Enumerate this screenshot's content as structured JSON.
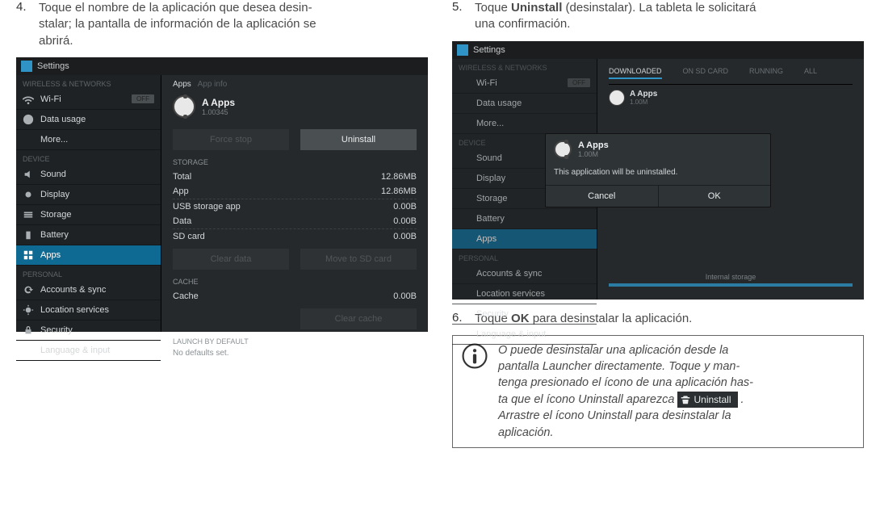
{
  "left": {
    "step_num": "4.",
    "step_text_a": "Toque el nombre de la aplicación que desea desin-",
    "step_text_b": "stalar; la pantalla de información de la aplicación se",
    "step_text_c": "abrirá."
  },
  "right": {
    "step5_num": "5.",
    "step5_a": "Toque ",
    "step5_bold": "Uninstall",
    "step5_b": " (desinstalar). La tableta le solicitará",
    "step5_c": "una confirmación.",
    "step6_num": "6.",
    "step6_a": "Toque ",
    "step6_bold": "OK",
    "step6_b": " para desinstalar la aplicación."
  },
  "shot_common": {
    "title": "Settings",
    "wireless_hdr": "WIRELESS & NETWORKS",
    "wifi": "Wi-Fi",
    "off": "OFF",
    "datausage": "Data usage",
    "more": "More...",
    "device_hdr": "DEVICE",
    "sound": "Sound",
    "display": "Display",
    "storage": "Storage",
    "battery": "Battery",
    "apps": "Apps",
    "personal_hdr": "PERSONAL",
    "accounts": "Accounts & sync",
    "location": "Location services",
    "security": "Security",
    "language": "Language & input"
  },
  "shot1": {
    "breadcrumb_a": "Apps",
    "breadcrumb_b": "App info",
    "app_name": "A Apps",
    "app_ver": "1.00345",
    "force_stop": "Force stop",
    "uninstall": "Uninstall",
    "storage_hdr": "STORAGE",
    "total": "Total",
    "total_v": "12.86MB",
    "app": "App",
    "app_v": "12.86MB",
    "usb": "USB storage app",
    "usb_v": "0.00B",
    "data": "Data",
    "data_v": "0.00B",
    "sdcard": "SD card",
    "sdcard_v": "0.00B",
    "clear_data": "Clear data",
    "move_sd": "Move to SD card",
    "cache_hdr": "CACHE",
    "cache": "Cache",
    "cache_v": "0.00B",
    "clear_cache": "Clear cache",
    "launch_hdr": "LAUNCH BY DEFAULT",
    "no_defaults": "No defaults set."
  },
  "shot2": {
    "tab_downloaded": "DOWNLOADED",
    "tab_sd": "ON SD CARD",
    "tab_running": "RUNNING",
    "tab_all": "ALL",
    "app_name": "A Apps",
    "app_size": "1.00M",
    "dlg_title": "A Apps",
    "dlg_sub": "1.00M",
    "dlg_msg": "This application will be uninstalled.",
    "dlg_cancel": "Cancel",
    "dlg_ok": "OK",
    "internal": "Internal storage"
  },
  "tip": {
    "l1": "O puede desinstalar una aplicación desde la",
    "l2": "pantalla Launcher directamente. Toque y man-",
    "l3": "tenga presionado el ícono de una aplicación has-",
    "l4a": "ta que el ícono Uninstall aparezca ",
    "badge": "Uninstall",
    "l4b": " .",
    "l5": "Arrastre el ícono Uninstall para desinstalar la",
    "l6": "aplicación."
  }
}
